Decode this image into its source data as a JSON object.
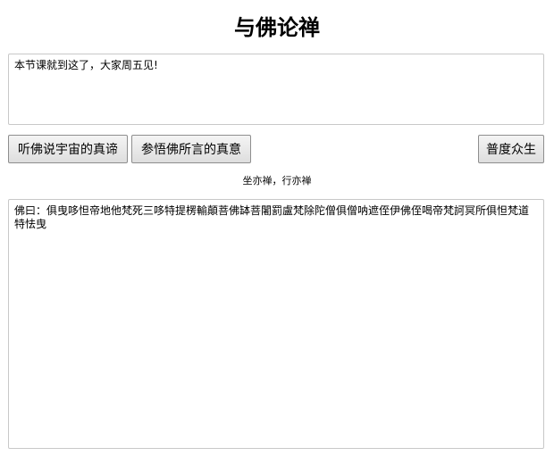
{
  "header": {
    "title": "与佛论禅"
  },
  "input": {
    "value": "本节课就到这了，大家周五见!"
  },
  "buttons": {
    "encode_label": "听佛说宇宙的真谛",
    "decode_label": "参悟佛所言的真意",
    "spread_label": "普度众生"
  },
  "caption": {
    "text": "坐亦禅，行亦禅"
  },
  "output": {
    "value": "佛曰：俱曳哆怛帝地他梵死三哆特提楞輸顛菩佛缽菩闍罰盧梵除陀僧俱僧呐遮侄伊佛侄喝帝梵訶冥所俱怛梵道特怯曳"
  }
}
